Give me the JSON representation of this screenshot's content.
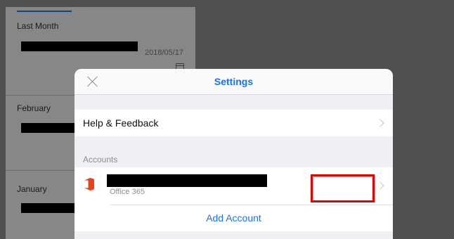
{
  "background_list": {
    "sections": [
      {
        "label": "Last Month"
      },
      {
        "label": "February"
      },
      {
        "label": "January"
      }
    ],
    "date": "2018/05/17"
  },
  "modal": {
    "title": "Settings",
    "help_label": "Help & Feedback",
    "accounts_header": "Accounts",
    "account_type": "Office 365",
    "add_account_label": "Add Account"
  }
}
